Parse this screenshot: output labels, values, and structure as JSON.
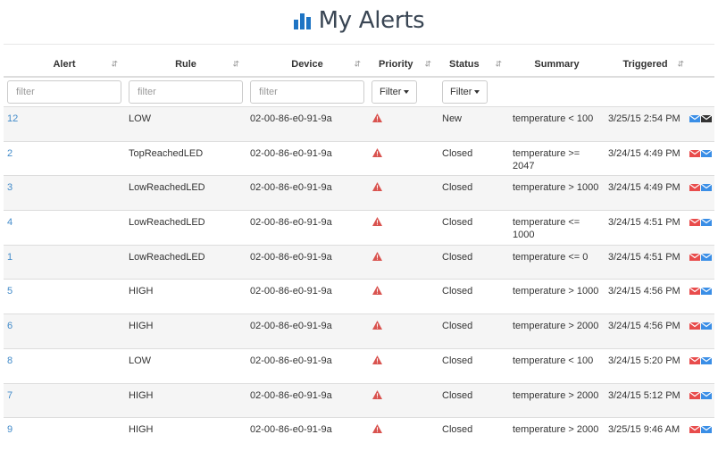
{
  "page": {
    "title": "My Alerts"
  },
  "columns": {
    "alert": "Alert",
    "rule": "Rule",
    "device": "Device",
    "priority": "Priority",
    "status": "Status",
    "summary": "Summary",
    "triggered": "Triggered"
  },
  "filters": {
    "alert_placeholder": "filter",
    "rule_placeholder": "filter",
    "device_placeholder": "filter",
    "priority_button": "Filter",
    "status_button": "Filter"
  },
  "colors": {
    "link": "#428bca",
    "priority_high": "#d9534f",
    "mail_red": "#e84c4c",
    "mail_blue": "#3a8ee6",
    "mail_dark": "#333333"
  },
  "rows": [
    {
      "id": "12",
      "rule": "LOW",
      "device": "02-00-86-e0-91-9a",
      "priority_icon": "warning-icon",
      "status": "New",
      "summary": "temperature < 100",
      "triggered": "3/25/15 2:54 PM",
      "actions": [
        "mail-blue",
        "mail-dark"
      ]
    },
    {
      "id": "2",
      "rule": "TopReachedLED",
      "device": "02-00-86-e0-91-9a",
      "priority_icon": "warning-icon",
      "status": "Closed",
      "summary": "temperature >= 2047",
      "triggered": "3/24/15 4:49 PM",
      "actions": [
        "mail-red",
        "mail-blue"
      ]
    },
    {
      "id": "3",
      "rule": "LowReachedLED",
      "device": "02-00-86-e0-91-9a",
      "priority_icon": "warning-icon",
      "status": "Closed",
      "summary": "temperature > 1000",
      "triggered": "3/24/15 4:49 PM",
      "actions": [
        "mail-red",
        "mail-blue"
      ]
    },
    {
      "id": "4",
      "rule": "LowReachedLED",
      "device": "02-00-86-e0-91-9a",
      "priority_icon": "warning-icon",
      "status": "Closed",
      "summary": "temperature <= 1000",
      "triggered": "3/24/15 4:51 PM",
      "actions": [
        "mail-red",
        "mail-blue"
      ]
    },
    {
      "id": "1",
      "rule": "LowReachedLED",
      "device": "02-00-86-e0-91-9a",
      "priority_icon": "warning-icon",
      "status": "Closed",
      "summary": "temperature <= 0",
      "triggered": "3/24/15 4:51 PM",
      "actions": [
        "mail-red",
        "mail-blue"
      ]
    },
    {
      "id": "5",
      "rule": "HIGH",
      "device": "02-00-86-e0-91-9a",
      "priority_icon": "warning-icon",
      "status": "Closed",
      "summary": "temperature > 1000",
      "triggered": "3/24/15 4:56 PM",
      "actions": [
        "mail-red",
        "mail-blue"
      ]
    },
    {
      "id": "6",
      "rule": "HIGH",
      "device": "02-00-86-e0-91-9a",
      "priority_icon": "warning-icon",
      "status": "Closed",
      "summary": "temperature > 2000",
      "triggered": "3/24/15 4:56 PM",
      "actions": [
        "mail-red",
        "mail-blue"
      ]
    },
    {
      "id": "8",
      "rule": "LOW",
      "device": "02-00-86-e0-91-9a",
      "priority_icon": "warning-icon",
      "status": "Closed",
      "summary": "temperature < 100",
      "triggered": "3/24/15 5:20 PM",
      "actions": [
        "mail-red",
        "mail-blue"
      ]
    },
    {
      "id": "7",
      "rule": "HIGH",
      "device": "02-00-86-e0-91-9a",
      "priority_icon": "warning-icon",
      "status": "Closed",
      "summary": "temperature > 2000",
      "triggered": "3/24/15 5:12 PM",
      "actions": [
        "mail-red",
        "mail-blue"
      ]
    },
    {
      "id": "9",
      "rule": "HIGH",
      "device": "02-00-86-e0-91-9a",
      "priority_icon": "warning-icon",
      "status": "Closed",
      "summary": "temperature > 2000",
      "triggered": "3/25/15 9:46 AM",
      "actions": [
        "mail-red",
        "mail-blue"
      ]
    }
  ]
}
